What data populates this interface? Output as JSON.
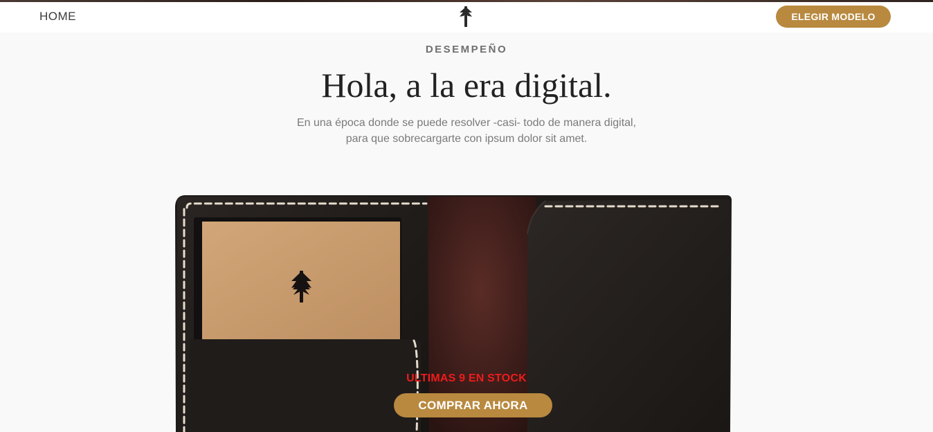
{
  "nav": {
    "home_label": "HOME",
    "logo_icon": "tree-icon",
    "cta_label": "ELEGIR MODELO"
  },
  "hero": {
    "eyebrow": "DESEMPEÑO",
    "headline": "Hola, a la era digital.",
    "subtext_line1": "En una época donde se puede resolver -casi- todo de manera digital,",
    "subtext_line2": "para que sobrecargarte con ipsum dolor sit amet."
  },
  "product": {
    "image_subject": "leather-wallet",
    "card_icon": "tree-icon",
    "stock_label": "ULTIMAS 9 EN STOCK",
    "buy_label": "COMPRAR AHORA"
  },
  "colors": {
    "accent_gold": "#b8893f",
    "stock_red": "#ee1c1c",
    "leather_dark": "#1e1a18",
    "suede_brown": "#4a2420",
    "kraft_card": "#c89a6d",
    "stitch": "#e6dccb"
  }
}
